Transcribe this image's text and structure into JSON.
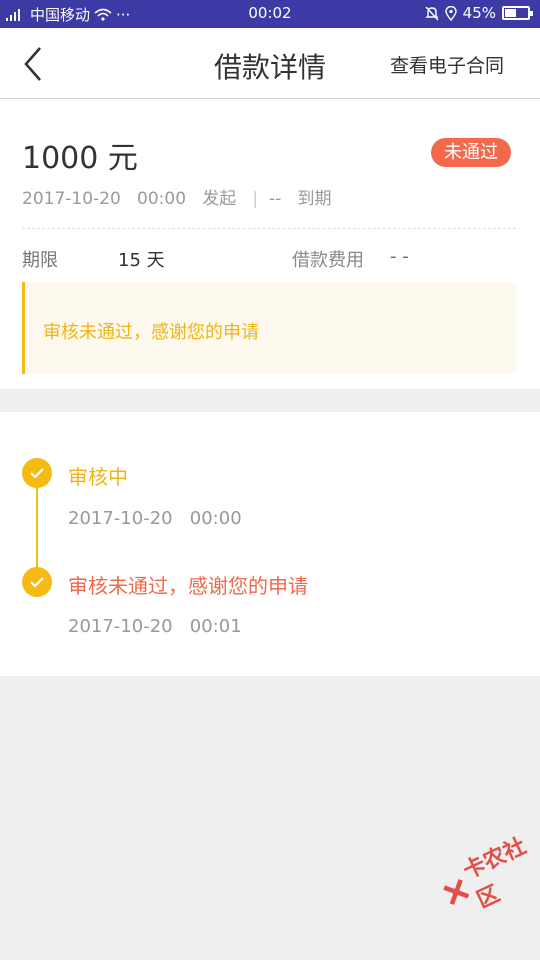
{
  "status_bar": {
    "carrier": "中国移动",
    "time": "00:02",
    "battery": "45%",
    "battery_level": 0.45
  },
  "nav": {
    "title": "借款详情",
    "contract_link": "查看电子合同"
  },
  "loan": {
    "amount": "1000 元",
    "status": "未通过",
    "start_date": "2017-10-20",
    "start_time": "00:00",
    "start_label": "发起",
    "separator": "|",
    "due_date": "--",
    "due_label": "到期",
    "term_label": "期限",
    "term_value": "15 天",
    "fee_label": "借款费用",
    "fee_value": "- -",
    "notice": "审核未通过，感谢您的申请"
  },
  "timeline": [
    {
      "title": "审核中",
      "time": "2017-10-20   00:00",
      "color": "#f0b415"
    },
    {
      "title": "审核未通过，感谢您的申请",
      "time": "2017-10-20   00:01",
      "color": "#ee6a4c"
    }
  ],
  "colors": {
    "accent_yellow": "#f6bb13",
    "status_red": "#f26a4b",
    "status_bar_bg": "#3d3aa6"
  },
  "watermark": "卡农社区"
}
